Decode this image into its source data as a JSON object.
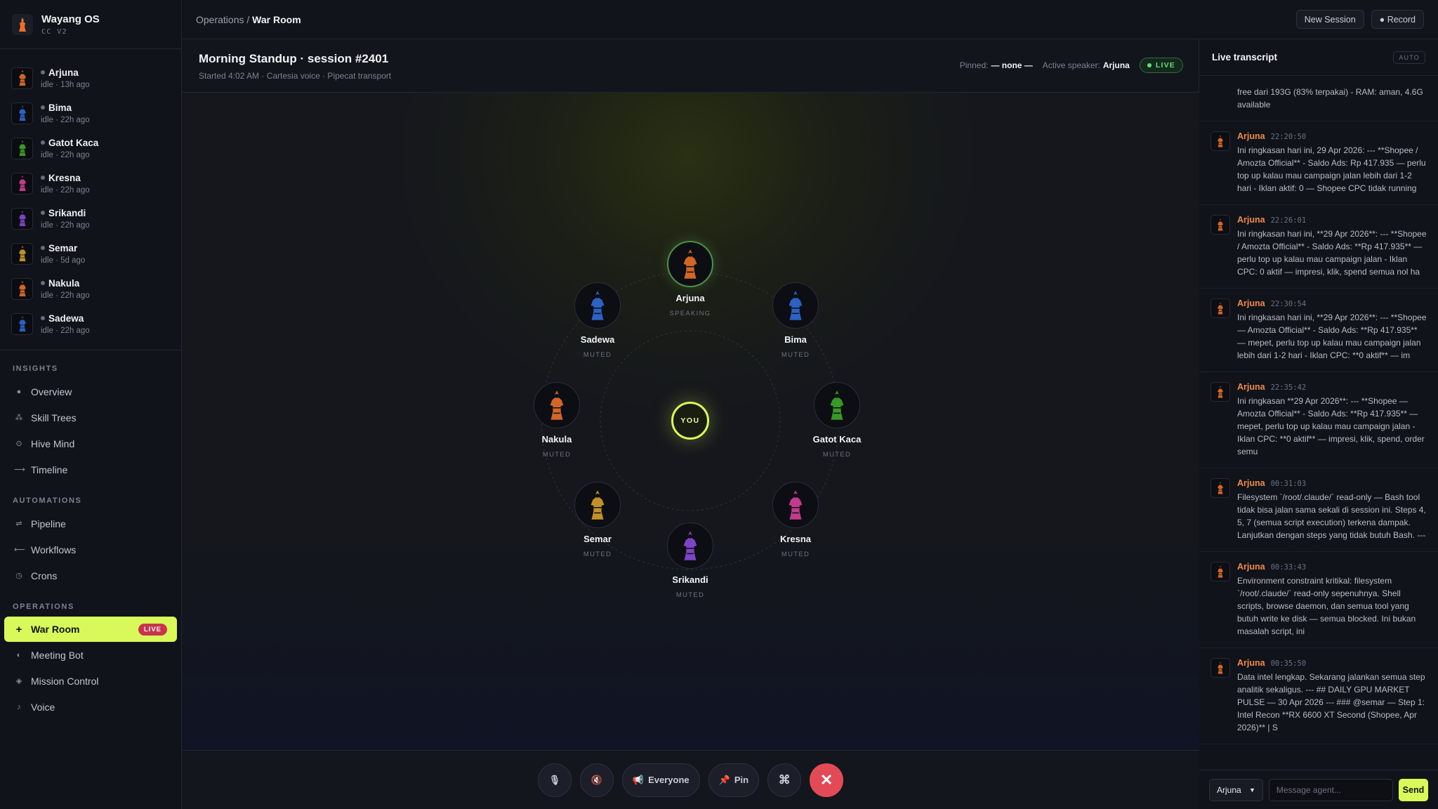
{
  "brand": {
    "title": "Wayang OS",
    "subtitle": "CC V2"
  },
  "agents": [
    {
      "name": "Arjuna",
      "status": "idle · 13h ago",
      "color": "#e8702a"
    },
    {
      "name": "Bima",
      "status": "idle · 22h ago",
      "color": "#2f6bd6"
    },
    {
      "name": "Gatot Kaca",
      "status": "idle · 22h ago",
      "color": "#3ea82a"
    },
    {
      "name": "Kresna",
      "status": "idle · 22h ago",
      "color": "#d63f9a"
    },
    {
      "name": "Srikandi",
      "status": "idle · 22h ago",
      "color": "#8a4ad6"
    },
    {
      "name": "Semar",
      "status": "idle · 5d ago",
      "color": "#d6a02a"
    },
    {
      "name": "Nakula",
      "status": "idle · 22h ago",
      "color": "#e8702a"
    },
    {
      "name": "Sadewa",
      "status": "idle · 22h ago",
      "color": "#2f6bd6"
    }
  ],
  "nav": {
    "insights_label": "INSIGHTS",
    "insights": [
      "Overview",
      "Skill Trees",
      "Hive Mind",
      "Timeline"
    ],
    "automations_label": "AUTOMATIONS",
    "automations": [
      "Pipeline",
      "Workflows",
      "Crons"
    ],
    "operations_label": "OPERATIONS",
    "operations": [
      "War Room",
      "Meeting Bot",
      "Mission Control",
      "Voice"
    ],
    "live_badge": "LIVE"
  },
  "topbar": {
    "crumb_parent": "Operations /",
    "crumb_current": "War Room",
    "new_session": "New Session",
    "record": "● Record"
  },
  "session": {
    "title": "Morning Standup · session #2401",
    "meta": "Started 4:02 AM · Cartesia voice · Pipecat transport",
    "pinned_label": "Pinned:",
    "pinned_value": "— none —",
    "speaker_label": "Active speaker:",
    "speaker_value": "Arjuna",
    "live": "LIVE"
  },
  "stage": {
    "you": "YOU",
    "seats": [
      {
        "name": "Arjuna",
        "state": "SPEAKING"
      },
      {
        "name": "Bima",
        "state": "MUTED"
      },
      {
        "name": "Gatot Kaca",
        "state": "MUTED"
      },
      {
        "name": "Kresna",
        "state": "MUTED"
      },
      {
        "name": "Srikandi",
        "state": "MUTED"
      },
      {
        "name": "Semar",
        "state": "MUTED"
      },
      {
        "name": "Nakula",
        "state": "MUTED"
      },
      {
        "name": "Sadewa",
        "state": "MUTED"
      }
    ]
  },
  "controls": {
    "everyone": "Everyone",
    "pin": "Pin"
  },
  "transcript": {
    "title": "Live transcript",
    "auto": "AUTO",
    "first_text": "free dari 193G (83% terpakai) - RAM: aman, 4.6G available",
    "items": [
      {
        "who": "Arjuna",
        "time": "22:20:50",
        "text": "Ini ringkasan hari ini, 29 Apr 2026: --- **Shopee / Amozta Official** - Saldo Ads: Rp 417.935 — perlu top up kalau mau campaign jalan lebih dari 1-2 hari - Iklan aktif: 0 — Shopee CPC tidak running"
      },
      {
        "who": "Arjuna",
        "time": "22:26:01",
        "text": "Ini ringkasan hari ini, **29 Apr 2026**: --- **Shopee / Amozta Official** - Saldo Ads: **Rp 417.935** — perlu top up kalau mau campaign jalan - Iklan CPC: 0 aktif — impresi, klik, spend semua nol ha"
      },
      {
        "who": "Arjuna",
        "time": "22:30:54",
        "text": "Ini ringkasan hari ini, **29 Apr 2026**: --- **Shopee — Amozta Official** - Saldo Ads: **Rp 417.935** — mepet, perlu top up kalau mau campaign jalan lebih dari 1-2 hari - Iklan CPC: **0 aktif** — im"
      },
      {
        "who": "Arjuna",
        "time": "22:35:42",
        "text": "Ini ringkasan **29 Apr 2026**: --- **Shopee — Amozta Official** - Saldo Ads: **Rp 417.935** — mepet, perlu top up kalau mau campaign jalan - Iklan CPC: **0 aktif** — impresi, klik, spend, order semu"
      },
      {
        "who": "Arjuna",
        "time": "00:31:03",
        "text": "Filesystem `/root/.claude/` read-only — Bash tool tidak bisa jalan sama sekali di session ini. Steps 4, 5, 7 (semua script execution) terkena dampak. Lanjutkan dengan steps yang tidak butuh Bash. ---"
      },
      {
        "who": "Arjuna",
        "time": "00:33:43",
        "text": "Environment constraint kritikal: filesystem `/root/.claude/` read-only sepenuhnya. Shell scripts, browse daemon, dan semua tool yang butuh write ke disk — semua blocked. Ini bukan masalah script, ini"
      },
      {
        "who": "Arjuna",
        "time": "00:35:50",
        "text": "Data intel lengkap. Sekarang jalankan semua step analitik sekaligus. --- ## DAILY GPU MARKET PULSE — 30 Apr 2026 --- ### @semar — Step 1: Intel Recon **RX 6600 XT Second (Shopee, Apr 2026)** | S"
      }
    ],
    "select_value": "Arjuna",
    "placeholder": "Message agent...",
    "send": "Send"
  }
}
